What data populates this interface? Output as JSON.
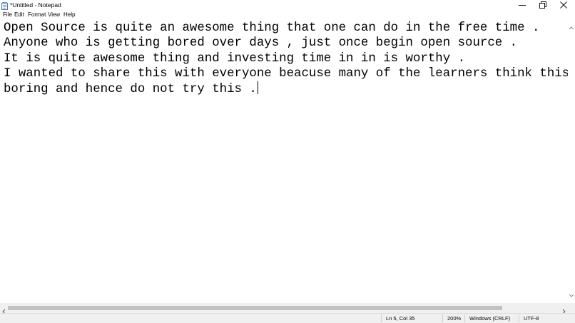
{
  "window": {
    "title": "*Untitled - Notepad",
    "controls": {
      "minimize": "minimize",
      "restore": "restore",
      "close": "close"
    }
  },
  "menu": {
    "items": [
      {
        "label": "File"
      },
      {
        "label": "Edit"
      },
      {
        "label": "Format"
      },
      {
        "label": "View"
      },
      {
        "label": "Help"
      }
    ]
  },
  "editor": {
    "lines": [
      "Open Source is quite an awesome thing that one can do in the free time .",
      "Anyone who is getting bored over days , just once begin open source .",
      "It is quite awesome thing and investing time in in is worthy .",
      "I wanted to share this with everyone beacuse many of the learners think this",
      "boring and hence do not try this ."
    ]
  },
  "status": {
    "position": "Ln 5, Col 35",
    "zoom": "200%",
    "line_ending": "Windows (CRLF)",
    "encoding": "UTF-8"
  },
  "icons": {
    "app": "notepad-icon",
    "minimize": "minimize-icon",
    "restore": "restore-icon",
    "close": "close-icon"
  },
  "colors": {
    "background": "#ffffff",
    "statusbar": "#f0f0f0",
    "scroll_thumb": "#c2c2c2"
  }
}
